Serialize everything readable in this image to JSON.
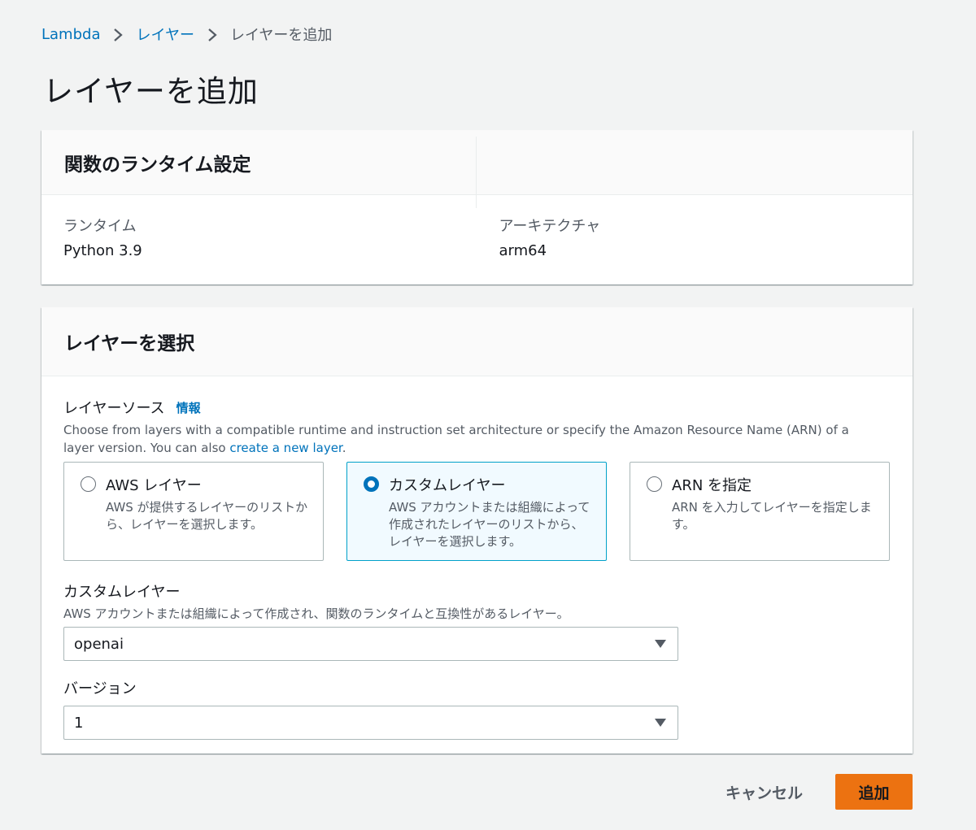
{
  "breadcrumb": {
    "items": [
      {
        "label": "Lambda"
      },
      {
        "label": "レイヤー"
      },
      {
        "label": "レイヤーを追加"
      }
    ]
  },
  "page": {
    "title": "レイヤーを追加"
  },
  "runtime_panel": {
    "title": "関数のランタイム設定",
    "runtime_label": "ランタイム",
    "runtime_value": "Python 3.9",
    "arch_label": "アーキテクチャ",
    "arch_value": "arm64"
  },
  "layer_panel": {
    "title": "レイヤーを選択",
    "source_label": "レイヤーソース",
    "info_link": "情報",
    "description": "Choose from layers with a compatible runtime and instruction set architecture or specify the Amazon Resource Name (ARN) of a layer version. You can also ",
    "description_link": "create a new layer",
    "description_end": ".",
    "options": [
      {
        "title": "AWS レイヤー",
        "description": "AWS が提供するレイヤーのリストから、レイヤーを選択します。",
        "selected": false
      },
      {
        "title": "カスタムレイヤー",
        "description": "AWS アカウントまたは組織によって作成されたレイヤーのリストから、レイヤーを選択します。",
        "selected": true
      },
      {
        "title": "ARN を指定",
        "description": "ARN を入力してレイヤーを指定します。",
        "selected": false
      }
    ],
    "custom_layer": {
      "label": "カスタムレイヤー",
      "hint": "AWS アカウントまたは組織によって作成され、関数のランタイムと互換性があるレイヤー。",
      "value": "openai"
    },
    "version": {
      "label": "バージョン",
      "value": "1"
    }
  },
  "actions": {
    "cancel": "キャンセル",
    "add": "追加"
  },
  "colors": {
    "primary": "#ec7211",
    "link": "#0073bb",
    "selected_bg": "#f1faff"
  }
}
